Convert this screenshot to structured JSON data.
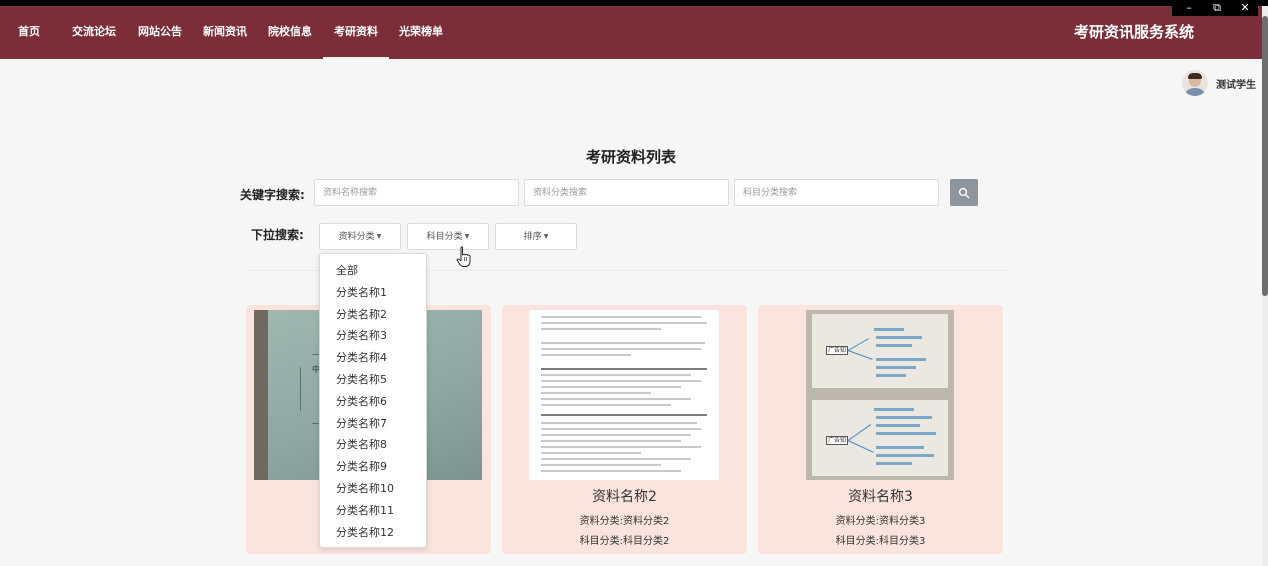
{
  "window": {
    "minimize": "–",
    "restore": "⧉",
    "close": "✕"
  },
  "nav": {
    "items": [
      "首页",
      "交流论坛",
      "网站公告",
      "新闻资讯",
      "院校信息",
      "考研资料",
      "光荣榜单"
    ],
    "active_index": 5,
    "brand": "考研资讯服务系统",
    "bar_color": "#7b2d38"
  },
  "user": {
    "name": "测试学生"
  },
  "page_title": "考研资料列表",
  "search": {
    "keyword_label": "关键字搜索:",
    "name_placeholder": "资料名称搜索",
    "category_placeholder": "资料分类搜索",
    "subject_placeholder": "科目分类搜索",
    "button_icon": "search-icon"
  },
  "dropdown_search": {
    "label": "下拉搜索:",
    "buttons": [
      "资料分类",
      "科目分类",
      "排序"
    ],
    "open_index": 0,
    "options": [
      "全部",
      "分类名称1",
      "分类名称2",
      "分类名称3",
      "分类名称4",
      "分类名称5",
      "分类名称6",
      "分类名称7",
      "分类名称8",
      "分类名称9",
      "分类名称10",
      "分类名称11",
      "分类名称12"
    ]
  },
  "cards": [
    {
      "title": "",
      "category": "",
      "subject": ""
    },
    {
      "title": "资料名称2",
      "category": "资料分类:资料分类2",
      "subject": "科目分类:科目分类2"
    },
    {
      "title": "资料名称3",
      "category": "资料分类:资料分类3",
      "subject": "科目分类:科目分类3"
    }
  ],
  "thumb_text": {
    "card1": "中",
    "card3_top": "广告知识",
    "card3_bottom": "广告知识"
  }
}
